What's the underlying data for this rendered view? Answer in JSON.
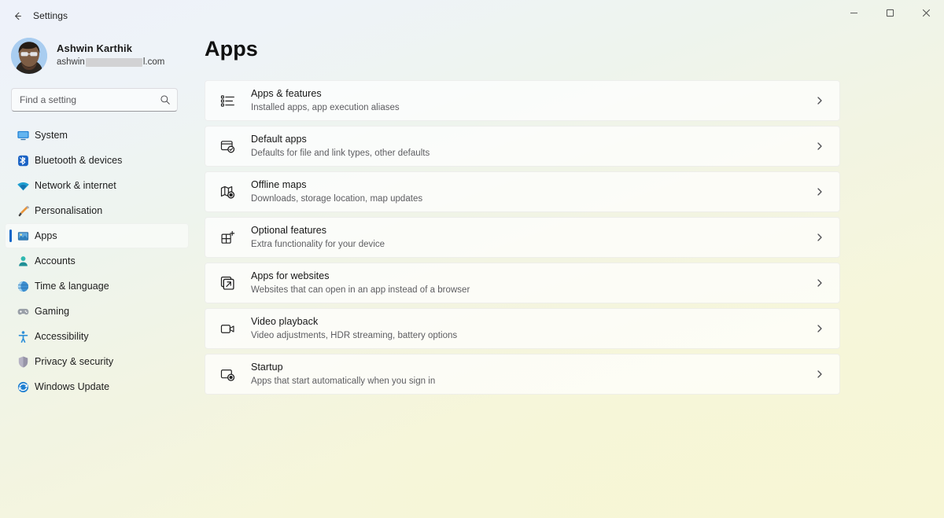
{
  "window": {
    "app_title": "Settings",
    "back_icon": "back-arrow-icon",
    "minimize_label": "Minimize",
    "maximize_label": "Maximize",
    "close_label": "Close"
  },
  "account": {
    "name": "Ashwin Karthik",
    "email_prefix": "ashwin",
    "email_suffix": "l.com",
    "avatar_alt": "user-avatar"
  },
  "search": {
    "placeholder": "Find a setting",
    "value": "",
    "icon": "search-icon"
  },
  "sidebar": {
    "items": [
      {
        "label": "System",
        "icon": "monitor-icon",
        "selected": false
      },
      {
        "label": "Bluetooth & devices",
        "icon": "bluetooth-icon",
        "selected": false
      },
      {
        "label": "Network & internet",
        "icon": "wifi-icon",
        "selected": false
      },
      {
        "label": "Personalisation",
        "icon": "paintbrush-icon",
        "selected": false
      },
      {
        "label": "Apps",
        "icon": "apps-icon",
        "selected": true
      },
      {
        "label": "Accounts",
        "icon": "person-icon",
        "selected": false
      },
      {
        "label": "Time & language",
        "icon": "clock-globe-icon",
        "selected": false
      },
      {
        "label": "Gaming",
        "icon": "gamepad-icon",
        "selected": false
      },
      {
        "label": "Accessibility",
        "icon": "accessibility-icon",
        "selected": false
      },
      {
        "label": "Privacy & security",
        "icon": "shield-icon",
        "selected": false
      },
      {
        "label": "Windows Update",
        "icon": "update-icon",
        "selected": false
      }
    ]
  },
  "main": {
    "title": "Apps",
    "cards": [
      {
        "title": "Apps & features",
        "subtitle": "Installed apps, app execution aliases",
        "icon": "list-icon",
        "chevron": "chevron-right-icon"
      },
      {
        "title": "Default apps",
        "subtitle": "Defaults for file and link types, other defaults",
        "icon": "default-apps-icon",
        "chevron": "chevron-right-icon"
      },
      {
        "title": "Offline maps",
        "subtitle": "Downloads, storage location, map updates",
        "icon": "map-icon",
        "chevron": "chevron-right-icon"
      },
      {
        "title": "Optional features",
        "subtitle": "Extra functionality for your device",
        "icon": "grid-plus-icon",
        "chevron": "chevron-right-icon"
      },
      {
        "title": "Apps for websites",
        "subtitle": "Websites that can open in an app instead of a browser",
        "icon": "external-link-icon",
        "chevron": "chevron-right-icon"
      },
      {
        "title": "Video playback",
        "subtitle": "Video adjustments, HDR streaming, battery options",
        "icon": "video-camera-icon",
        "chevron": "chevron-right-icon"
      },
      {
        "title": "Startup",
        "subtitle": "Apps that start automatically when you sign in",
        "icon": "startup-icon",
        "chevron": "chevron-right-icon"
      }
    ]
  },
  "colors": {
    "accent": "#0f66c8",
    "text_primary": "#161616",
    "text_secondary": "#5d5d61",
    "card_bg": "#ffffff"
  }
}
